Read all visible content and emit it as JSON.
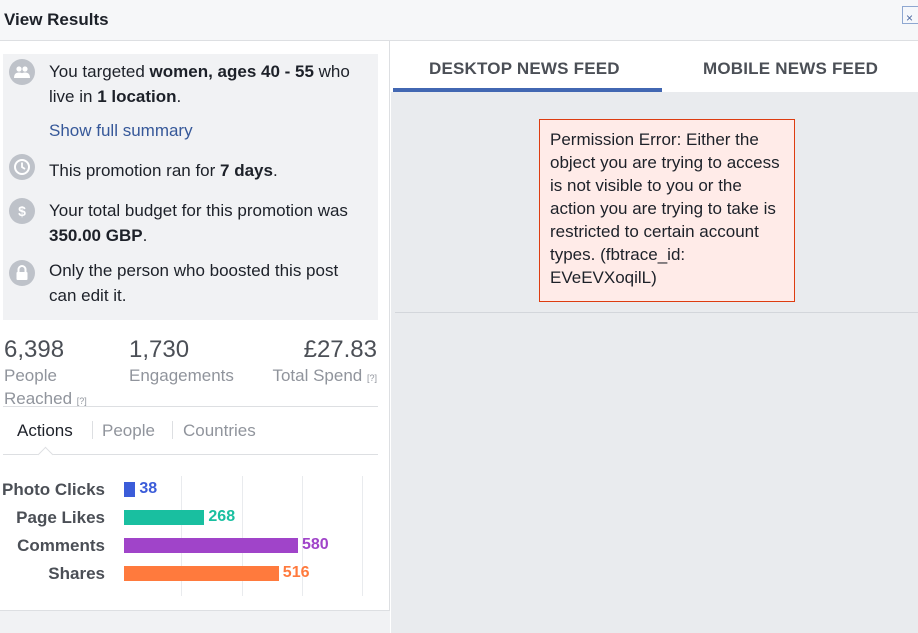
{
  "window": {
    "title": "View Results",
    "close_glyph": "×"
  },
  "summary": {
    "targeting": {
      "pre": "You targeted ",
      "bold1": "women, ages 40 - 55",
      "mid": " who live in ",
      "bold2": "1 location",
      "post": ".",
      "icon": "people-icon"
    },
    "show_full_summary": "Show full summary",
    "duration": {
      "pre": "This promotion ran for ",
      "bold": "7 days",
      "post": ".",
      "icon": "clock-icon"
    },
    "budget": {
      "pre": "Your total budget for this promotion was ",
      "bold": "350.00 GBP",
      "post": ".",
      "icon": "dollar-icon"
    },
    "permissions": {
      "text": "Only the person who boosted this post can edit it.",
      "icon": "lock-icon"
    }
  },
  "metrics": {
    "people_reached": {
      "value": "6,398",
      "label_line1": "People",
      "label_line2": "Reached",
      "help": "[?]"
    },
    "engagements": {
      "value": "1,730",
      "label": "Engagements"
    },
    "total_spend": {
      "value": "£27.83",
      "label": "Total Spend",
      "help": "[?]"
    }
  },
  "tabs": [
    {
      "label": "Actions",
      "active": true
    },
    {
      "label": "People",
      "active": false
    },
    {
      "label": "Countries",
      "active": false
    }
  ],
  "chart_data": {
    "type": "bar",
    "orientation": "horizontal",
    "categories": [
      "Photo Clicks",
      "Page Likes",
      "Comments",
      "Shares"
    ],
    "values": [
      38,
      268,
      580,
      516
    ],
    "colors": [
      "#3b5cd9",
      "#19bfa0",
      "#a044c9",
      "#ff7a3d"
    ],
    "xlim": [
      0,
      840
    ],
    "grid": true
  },
  "feed_tabs": [
    {
      "label": "DESKTOP NEWS FEED",
      "active": true
    },
    {
      "label": "MOBILE NEWS FEED",
      "active": false
    }
  ],
  "error": {
    "message": "Permission Error: Either the object you are trying to access is not visible to you or the action you are trying to take is restricted to certain account types. (fbtrace_id: EVeEVXoqilL)"
  },
  "colors": {
    "accent": "#4267b2",
    "link": "#365899",
    "error_bg": "#ffebe8",
    "error_border": "#dd3c10"
  }
}
